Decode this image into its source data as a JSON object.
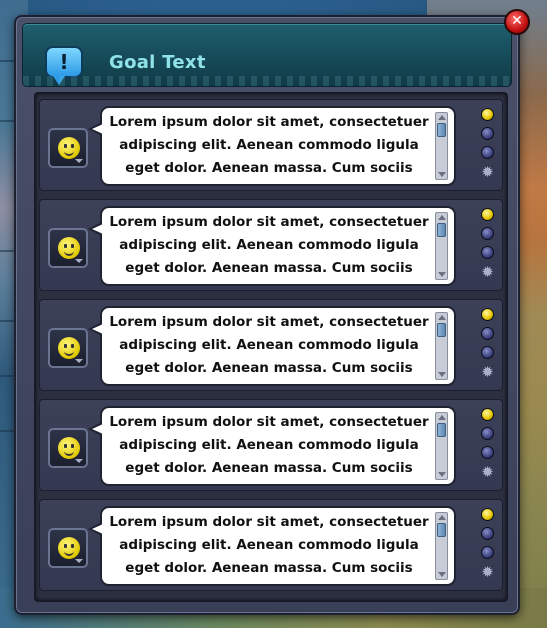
{
  "window": {
    "title": "Goal Text",
    "title_icon_glyph": "!",
    "close_glyph": "✕"
  },
  "colors": {
    "title_text": "#8fe3e8",
    "titlebar": "#174c5a",
    "window_frame": "#3a3f58",
    "bubble_bg": "#ffffff",
    "close_button": "#c21010",
    "status_dot_active": "#e6c400",
    "status_dot_inactive": "#3c4180"
  },
  "goals": [
    {
      "text": "Lorem ipsum dolor sit amet, consectetuer adipiscing elit. Aenean commodo ligula eget dolor. Aenean massa. Cum sociis natoque",
      "avatar_icon": "smiley-face-icon"
    },
    {
      "text": "Lorem ipsum dolor sit amet, consectetuer adipiscing elit. Aenean commodo ligula eget dolor. Aenean massa. Cum sociis natoque",
      "avatar_icon": "smiley-face-icon"
    },
    {
      "text": "Lorem ipsum dolor sit amet, consectetuer adipiscing elit. Aenean commodo ligula eget dolor. Aenean massa. Cum sociis natoque",
      "avatar_icon": "smiley-face-icon"
    },
    {
      "text": "Lorem ipsum dolor sit amet, consectetuer adipiscing elit. Aenean commodo ligula eget dolor. Aenean massa. Cum sociis natoque",
      "avatar_icon": "smiley-face-icon"
    },
    {
      "text": "Lorem ipsum dolor sit amet, consectetuer adipiscing elit. Aenean commodo ligula eget dolor. Aenean massa. Cum sociis natoque",
      "avatar_icon": "smiley-face-icon"
    }
  ],
  "side_controls": [
    "yellow-dot",
    "blue-dot",
    "blue-dot",
    "gear-icon"
  ]
}
